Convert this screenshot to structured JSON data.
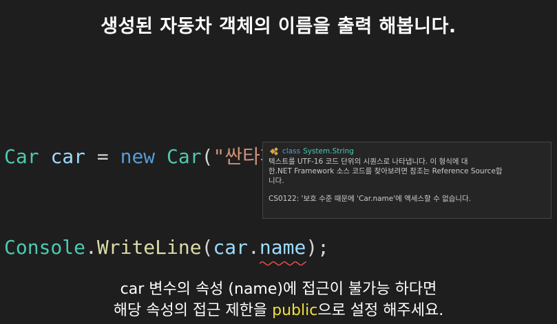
{
  "heading": "생성된 자동차 객체의 이름을 출력 해봅니다.",
  "code": {
    "line1": {
      "type1": "Car",
      "var": "car",
      "eq": " = ",
      "kw": "new",
      "type2": "Car",
      "open": "(",
      "str": "\"싼타페\"",
      "close": ");"
    },
    "line2": {
      "cls": "Console",
      "dot1": ".",
      "method": "WriteLine",
      "open": "(",
      "var": "car",
      "dot2": ".",
      "member": "name",
      "close": ");"
    }
  },
  "tooltip": {
    "keyword": "class",
    "type": "System.String",
    "desc_line1": "텍스트를 UTF-16 코드 단위의 시퀀스로 나타냅니다. 이 형식에 대",
    "desc_line2": "한.NET Framework 소스 코드를 찾아보려면 참조는 Reference Source합",
    "desc_line3": "니다.",
    "error": "CS0122: '보호 수준 때문에 'Car.name'에 액세스할 수 없습니다."
  },
  "subtitle": {
    "line1": "car 변수의 속성 (name)에 접근이 불가능 하다면",
    "line2_before": "해당 속성의 접근 제한을 ",
    "line2_highlight": "public",
    "line2_after": "으로 설정 해주세요."
  },
  "colors": {
    "background": "#1e1e1e",
    "type": "#4ec9b0",
    "variable": "#9cdcfe",
    "keyword": "#569cd6",
    "string": "#ce9178",
    "method": "#dcdcaa",
    "error_squiggle": "#f14c4c",
    "highlight": "#f0e040"
  }
}
